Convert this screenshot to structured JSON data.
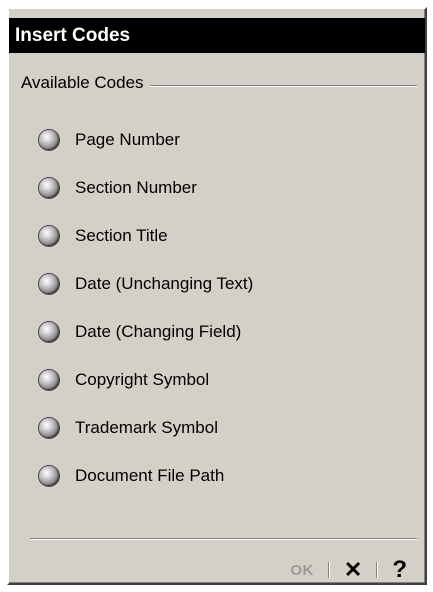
{
  "window": {
    "title": "Insert Codes"
  },
  "group": {
    "label": "Available Codes"
  },
  "options": [
    {
      "label": "Page Number",
      "selected": false
    },
    {
      "label": "Section Number",
      "selected": false
    },
    {
      "label": "Section Title",
      "selected": false
    },
    {
      "label": "Date (Unchanging Text)",
      "selected": false
    },
    {
      "label": "Date (Changing Field)",
      "selected": false
    },
    {
      "label": "Copyright Symbol",
      "selected": false
    },
    {
      "label": "Trademark Symbol",
      "selected": false
    },
    {
      "label": "Document File Path",
      "selected": false
    }
  ],
  "buttons": {
    "ok_label": "OK",
    "ok_enabled": false,
    "close_glyph": "✕",
    "help_glyph": "?"
  },
  "icons": {
    "radio": "radio-button-icon",
    "close": "close-icon",
    "help": "help-icon"
  }
}
